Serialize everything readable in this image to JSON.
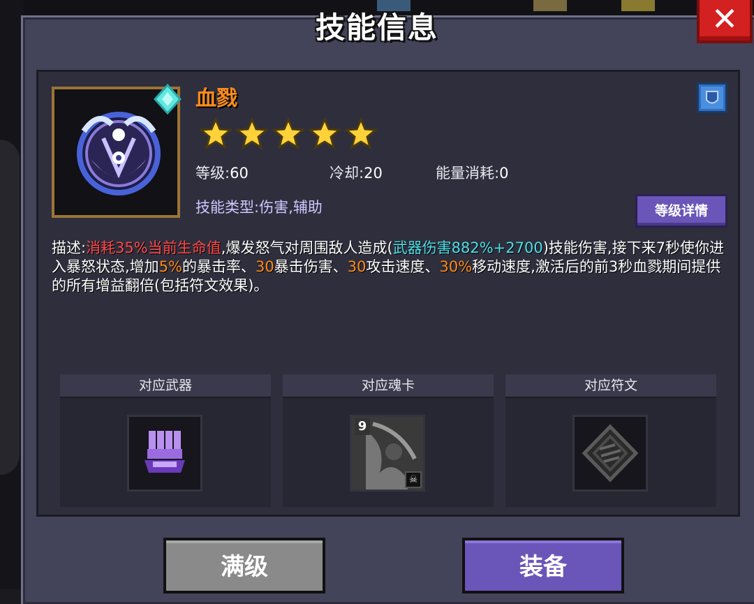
{
  "title": "技能信息",
  "close_label": "✕",
  "skill": {
    "name": "血戮",
    "stars": 5,
    "level_label": "等级:",
    "level_value": "60",
    "cooldown_label": "冷却:",
    "cooldown_value": "20",
    "energy_label": "能量消耗:",
    "energy_value": "0",
    "type_label": "技能类型:",
    "type_value": "伤害,辅助",
    "level_detail_button": "等级详情"
  },
  "description": {
    "prefix": "描述:",
    "p1_red": "消耗35%当前生命值",
    "p2": ",爆发怒气对周围敌人造成(",
    "p3_cyan": "武器伤害882%+2700",
    "p4": ")技能伤害,接下来7秒使你进入暴怒状态,增加",
    "p5_orange": "5%",
    "p6": "的暴击率、",
    "p7_orange": "30",
    "p8": "暴击伤害、",
    "p9_orange": "30",
    "p10": "攻击速度、",
    "p11_orange": "30%",
    "p12": "移动速度,激活后的前3秒血戮期间提供的所有增益翻倍(包括符文效果)。"
  },
  "slots": [
    {
      "title": "对应武器"
    },
    {
      "title": "对应魂卡",
      "card_level": "9"
    },
    {
      "title": "对应符文"
    }
  ],
  "buttons": {
    "max_level": "满级",
    "equip": "装备"
  },
  "colors": {
    "name_orange": "#ff8c1a",
    "highlight_red": "#ff4a4a",
    "highlight_cyan": "#4fe0e8",
    "button_purple": "#6a55b8",
    "close_red": "#d32020"
  }
}
